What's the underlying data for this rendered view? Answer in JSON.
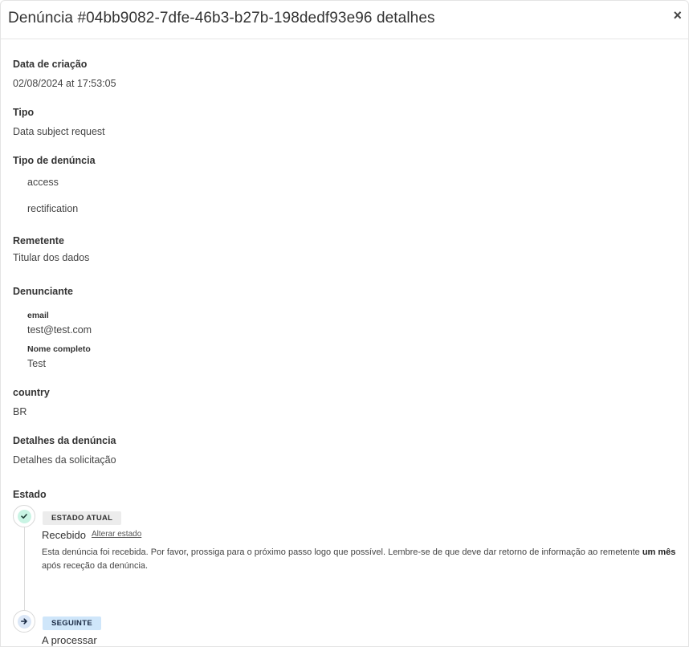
{
  "modal": {
    "title": "Denúncia #04bb9082-7dfe-46b3-b27b-198dedf93e96 detalhes",
    "close_label": "×"
  },
  "fields": {
    "created": {
      "label": "Data de criação",
      "value": "02/08/2024 at 17:53:05"
    },
    "type": {
      "label": "Tipo",
      "value": "Data subject request"
    },
    "report_type": {
      "label": "Tipo de denúncia",
      "items": [
        "access",
        "rectification"
      ]
    },
    "sender": {
      "label": "Remetente",
      "value": "Titular dos dados"
    },
    "reporter": {
      "label": "Denunciante",
      "email_label": "email",
      "email": "test@test.com",
      "name_label": "Nome completo",
      "name": "Test"
    },
    "country": {
      "label": "country",
      "value": "BR"
    },
    "details": {
      "label": "Detalhes da denúncia",
      "value": "Detalhes da solicitação"
    }
  },
  "state": {
    "label": "Estado",
    "current": {
      "badge": "ESTADO ATUAL",
      "title": "Recebido",
      "change_link": "Alterar estado",
      "desc_before": "Esta denúncia foi recebida. Por favor, prossiga para o próximo passo logo que possível. Lembre-se de que deve dar retorno de informação ao remetente ",
      "desc_bold": "um mês",
      "desc_after": " após receção da denúncia.",
      "icon": "check-icon"
    },
    "next": {
      "badge": "SEGUINTE",
      "title": "A processar",
      "icon": "arrow-right-icon"
    }
  },
  "colors": {
    "current_icon_bg": "#c9f4e4",
    "next_icon_bg": "#dbe7f7",
    "next_badge_bg": "#cfe6fa"
  }
}
